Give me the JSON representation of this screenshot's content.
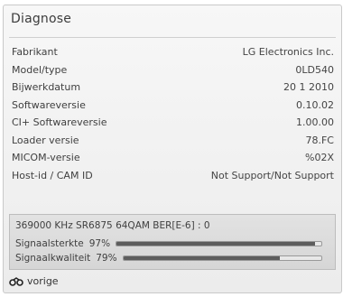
{
  "title": "Diagnose",
  "info": [
    {
      "label": "Fabrikant",
      "value": "LG Electronics Inc."
    },
    {
      "label": "Model/type",
      "value": "0LD540"
    },
    {
      "label": "Bijwerkdatum",
      "value": "20 1 2010"
    },
    {
      "label": "Softwareversie",
      "value": "0.10.02"
    },
    {
      "label": "CI+ Softwareversie",
      "value": "1.00.00"
    },
    {
      "label": "Loader versie",
      "value": "78.FC"
    },
    {
      "label": "MICOM-versie",
      "value": "%02X"
    },
    {
      "label": "Host-id / CAM ID",
      "value": "Not Support/Not Support"
    }
  ],
  "signal": {
    "frequency_text": "369000 KHz SR6875 64QAM BER[E-6] : 0",
    "strength_label": "Signaalsterkte",
    "strength_percent": "97%",
    "strength_value": 0.97,
    "quality_label": "Signaalkwaliteit",
    "quality_percent": "79%",
    "quality_value": 0.79
  },
  "footer": {
    "back_label": "vorige",
    "back_icon": "return-icon"
  }
}
